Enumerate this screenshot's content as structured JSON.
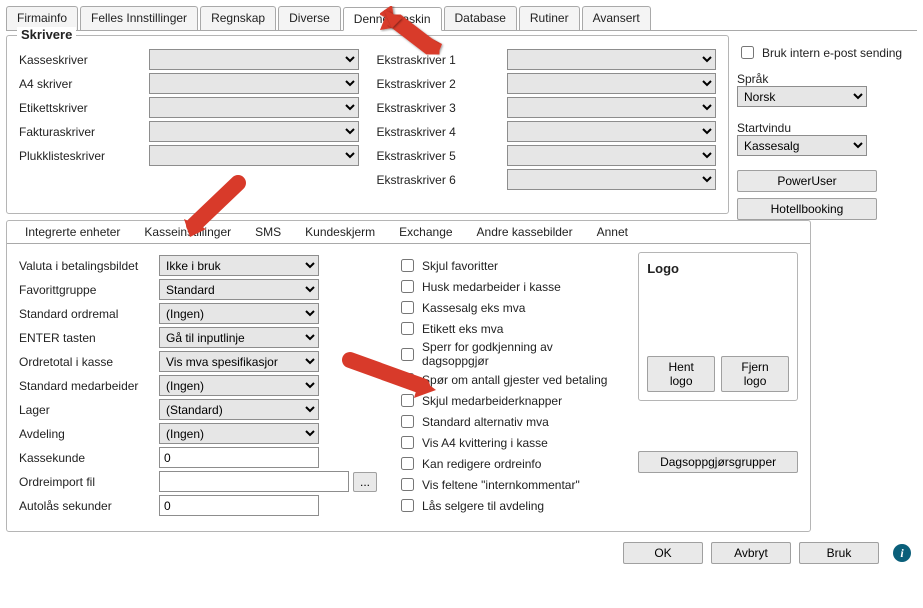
{
  "tabs": {
    "main": [
      "Firmainfo",
      "Felles Innstillinger",
      "Regnskap",
      "Diverse",
      "Denne maskin",
      "Database",
      "Rutiner",
      "Avansert"
    ],
    "main_active": 4,
    "sub": [
      "Integrerte enheter",
      "Kasseinstillinger",
      "SMS",
      "Kundeskjerm",
      "Exchange",
      "Andre kassebilder",
      "Annet"
    ],
    "sub_active": 1
  },
  "printers": {
    "title": "Skrivere",
    "left_labels": [
      "Kasseskriver",
      "A4 skriver",
      "Etikettskriver",
      "Fakturaskriver",
      "Plukklisteskriver"
    ],
    "right_labels": [
      "Ekstraskriver 1",
      "Ekstraskriver 2",
      "Ekstraskriver 3",
      "Ekstraskriver 4",
      "Ekstraskriver 5",
      "Ekstraskriver 6"
    ]
  },
  "side": {
    "email_checkbox": "Bruk intern e-post sending",
    "lang_label": "Språk",
    "lang_value": "Norsk",
    "startwin_label": "Startvindu",
    "startwin_value": "Kassesalg",
    "poweruser": "PowerUser",
    "hotelbooking": "Hotellbooking"
  },
  "form": {
    "rows": [
      {
        "label": "Valuta i betalingsbildet",
        "value": "Ikke i bruk",
        "type": "combo"
      },
      {
        "label": "Favorittgruppe",
        "value": "Standard",
        "type": "combo"
      },
      {
        "label": "Standard ordremal",
        "value": "(Ingen)",
        "type": "combo"
      },
      {
        "label": "ENTER tasten",
        "value": "Gå til inputlinje",
        "type": "combo"
      },
      {
        "label": "Ordretotal i kasse",
        "value": "Vis mva spesifikasjor",
        "type": "combo"
      },
      {
        "label": "Standard medarbeider",
        "value": "(Ingen)",
        "type": "combo"
      },
      {
        "label": "Lager",
        "value": "(Standard)",
        "type": "combo"
      },
      {
        "label": "Avdeling",
        "value": "(Ingen)",
        "type": "combo"
      },
      {
        "label": "Kassekunde",
        "value": "0",
        "type": "input"
      },
      {
        "label": "Ordreimport fil",
        "value": "",
        "type": "input-browse"
      },
      {
        "label": "Autolås sekunder",
        "value": "0",
        "type": "input"
      }
    ]
  },
  "checks": [
    "Skjul favoritter",
    "Husk medarbeider i kasse",
    "Kassesalg eks mva",
    "Etikett eks mva",
    "Sperr for godkjenning av dagsoppgjør",
    "Spør om antall gjester ved betaling",
    "Skjul medarbeiderknapper",
    "Standard alternativ mva",
    "Vis A4 kvittering i kasse",
    "Kan redigere ordreinfo",
    "Vis feltene \"internkommentar\"",
    "Lås selgere til avdeling"
  ],
  "logo": {
    "title": "Logo",
    "get": "Hent logo",
    "remove": "Fjern logo",
    "groups": "Dagsoppgjørsgrupper"
  },
  "footer": {
    "ok": "OK",
    "cancel": "Avbryt",
    "apply": "Bruk"
  },
  "browse_btn": "..."
}
